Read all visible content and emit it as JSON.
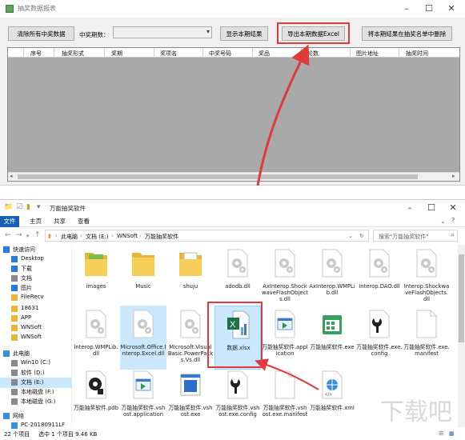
{
  "win1": {
    "title": "抽奖数据报表",
    "btn_clear": "清除所有中奖数据",
    "period_label": "中奖期数：",
    "period_value": "",
    "btn_show": "显示本期结果",
    "btn_export": "导出本期数据Excel",
    "btn_delete": "将本期结果在抽奖名单中删除",
    "columns": [
      "序号",
      "抽奖形式",
      "奖期",
      "奖项名",
      "中奖号码",
      "奖品",
      "轮数",
      "图片地址",
      "抽奖时间"
    ]
  },
  "win2": {
    "title": "万能抽奖软件",
    "tabs": [
      "文件",
      "主页",
      "共享",
      "查看"
    ],
    "breadcrumb": [
      "此电脑",
      "文档 (E:)",
      "WNSoft",
      "万能抽奖软件"
    ],
    "search_placeholder": "搜索\"万能抽奖软件\"",
    "nav": [
      {
        "label": "快速访问",
        "icon": "star-icon"
      },
      {
        "label": "Desktop",
        "icon": "desktop-icon"
      },
      {
        "label": "下载",
        "icon": "download-icon"
      },
      {
        "label": "文档",
        "icon": "document-icon"
      },
      {
        "label": "图片",
        "icon": "picture-icon"
      },
      {
        "label": "FileRecv",
        "icon": "folder-icon"
      },
      {
        "label": "18631",
        "icon": "folder-icon"
      },
      {
        "label": "APP",
        "icon": "folder-icon"
      },
      {
        "label": "WNSoft",
        "icon": "folder-icon"
      },
      {
        "label": "WNSoft",
        "icon": "folder-icon"
      },
      {
        "label": "此电脑",
        "icon": "computer-icon"
      },
      {
        "label": "Win10 (C:)",
        "icon": "drive-icon"
      },
      {
        "label": "软件 (D:)",
        "icon": "drive-icon"
      },
      {
        "label": "文档 (E:)",
        "icon": "drive-icon"
      },
      {
        "label": "本地磁盘 (F:)",
        "icon": "drive-icon"
      },
      {
        "label": "本地磁盘 (G:)",
        "icon": "drive-icon"
      },
      {
        "label": "网络",
        "icon": "network-icon"
      },
      {
        "label": "PC-20180911LF",
        "icon": "computer-icon"
      }
    ],
    "files": [
      {
        "name": "images",
        "type": "folder-img"
      },
      {
        "name": "Music",
        "type": "folder"
      },
      {
        "name": "shuju",
        "type": "folder-doc"
      },
      {
        "name": "adodb.dll",
        "type": "dll"
      },
      {
        "name": "AxInterop.ShockwaveFlashObjects.dll",
        "type": "dll"
      },
      {
        "name": "AxInterop.WMPLib.dll",
        "type": "dll"
      },
      {
        "name": "Interop.DAO.dll",
        "type": "dll"
      },
      {
        "name": "Interop.ShockwaveFlashObjects.dll",
        "type": "dll"
      },
      {
        "name": "Interop.WMPLib.dll",
        "type": "dll"
      },
      {
        "name": "Microsoft.Office.Interop.Excel.dll",
        "type": "dll"
      },
      {
        "name": "Microsoft.VisualBasic.PowerPacks.Vs.dll",
        "type": "dll"
      },
      {
        "name": "数据.xlsx",
        "type": "xlsx"
      },
      {
        "name": "万能抽奖软件.application",
        "type": "app"
      },
      {
        "name": "万能抽奖软件.exe",
        "type": "exe-green"
      },
      {
        "name": "万能抽奖软件.exe.config",
        "type": "config"
      },
      {
        "name": "万能抽奖软件.exe.manifest",
        "type": "blank"
      },
      {
        "name": "万能抽奖软件.pdb",
        "type": "pdb"
      },
      {
        "name": "万能抽奖软件.vshost.application",
        "type": "app"
      },
      {
        "name": "万能抽奖软件.vshost.exe",
        "type": "exe-blue"
      },
      {
        "name": "万能抽奖软件.vshost.exe.config",
        "type": "config"
      },
      {
        "name": "万能抽奖软件.vshost.exe.manifest",
        "type": "blank"
      },
      {
        "name": "万能抽奖软件.xml",
        "type": "xml"
      }
    ],
    "status_count": "22 个项目",
    "status_selected": "选中 1 个项目  9.46 KB"
  },
  "watermark": "下载吧"
}
